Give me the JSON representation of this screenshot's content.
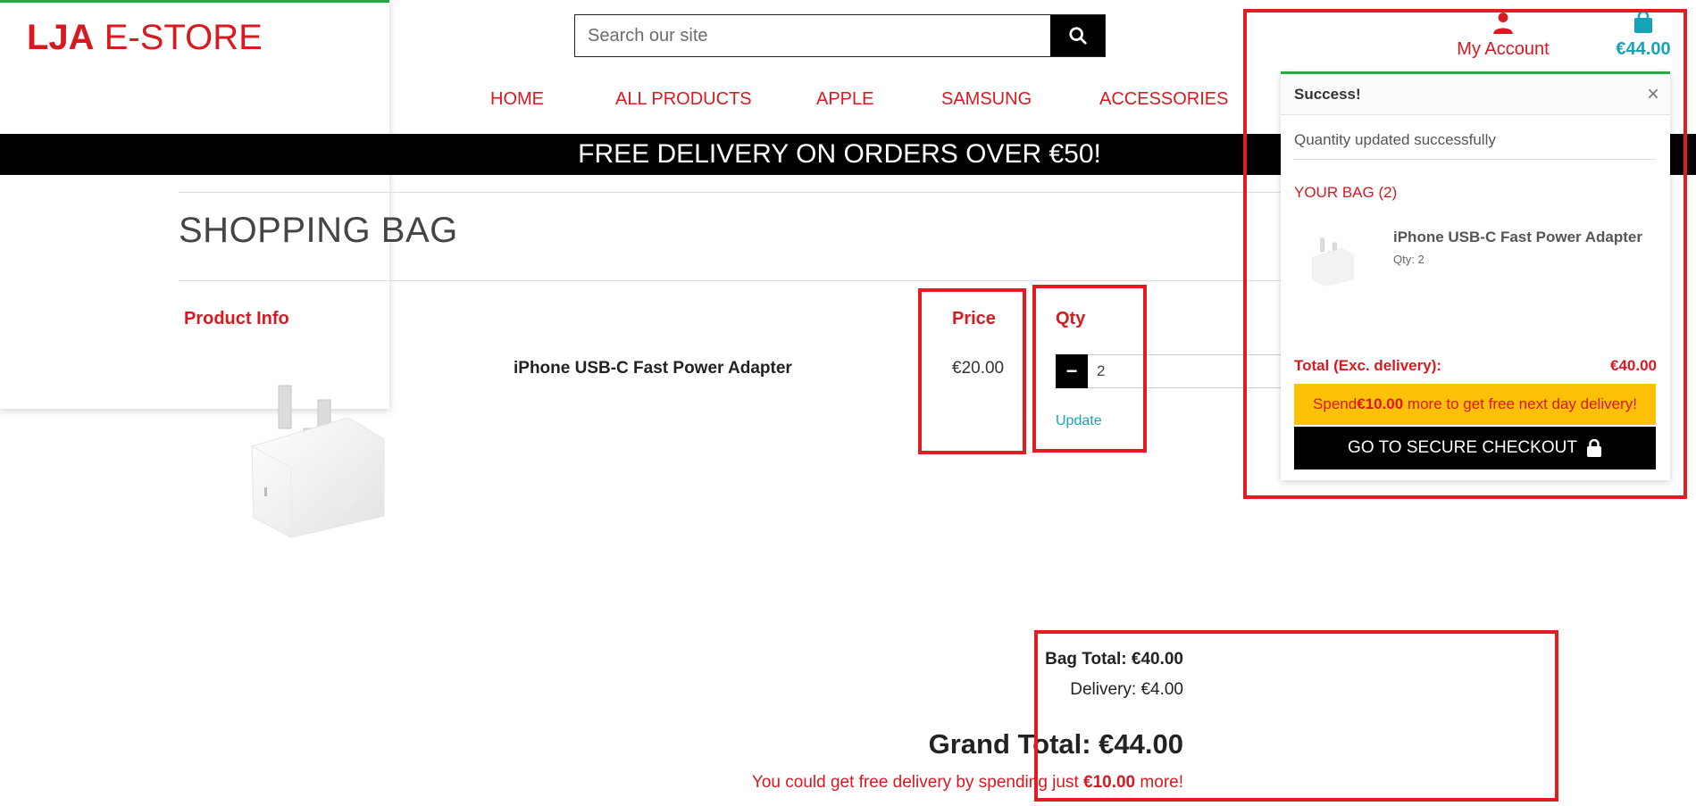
{
  "header": {
    "logo_bold": "LJA",
    "logo_rest": " E-STORE",
    "search_placeholder": "Search our site",
    "account_label": "My Account",
    "bag_total": "€44.00"
  },
  "nav": [
    "HOME",
    "ALL PRODUCTS",
    "APPLE",
    "SAMSUNG",
    "ACCESSORIES"
  ],
  "banner": "FREE DELIVERY ON ORDERS OVER €50!",
  "page_title": "SHOPPING BAG",
  "table": {
    "headers": {
      "product": "Product Info",
      "price": "Price",
      "qty": "Qty"
    },
    "row": {
      "name": "iPhone USB-C Fast Power Adapter",
      "price": "€20.00",
      "qty": "2",
      "minus": "−",
      "update": "Update"
    }
  },
  "totals": {
    "bag_total": "Bag Total: €40.00",
    "delivery": "Delivery: €4.00",
    "grand_total": "Grand Total: €44.00",
    "free_pre": "You could get free delivery by spending just ",
    "free_amount": "€10.00",
    "free_post": " more!"
  },
  "toast": {
    "title": "Success!",
    "close": "×",
    "message": "Quantity updated successfully",
    "bag_label": "YOUR BAG (2)",
    "product_name": "iPhone USB-C Fast Power Adapter",
    "product_qty": "Qty: 2",
    "total_label": "Total (Exc. delivery):",
    "total_value": "€40.00",
    "spend_pre": "Spend ",
    "spend_amount": "€10.00",
    "spend_post": " more to get free next day delivery!",
    "checkout": "GO TO SECURE CHECKOUT"
  },
  "colors": {
    "brand_red": "#d71920",
    "accent_teal": "#17a2b8",
    "success_green": "#28a745",
    "warning_yellow": "#ffc107"
  }
}
